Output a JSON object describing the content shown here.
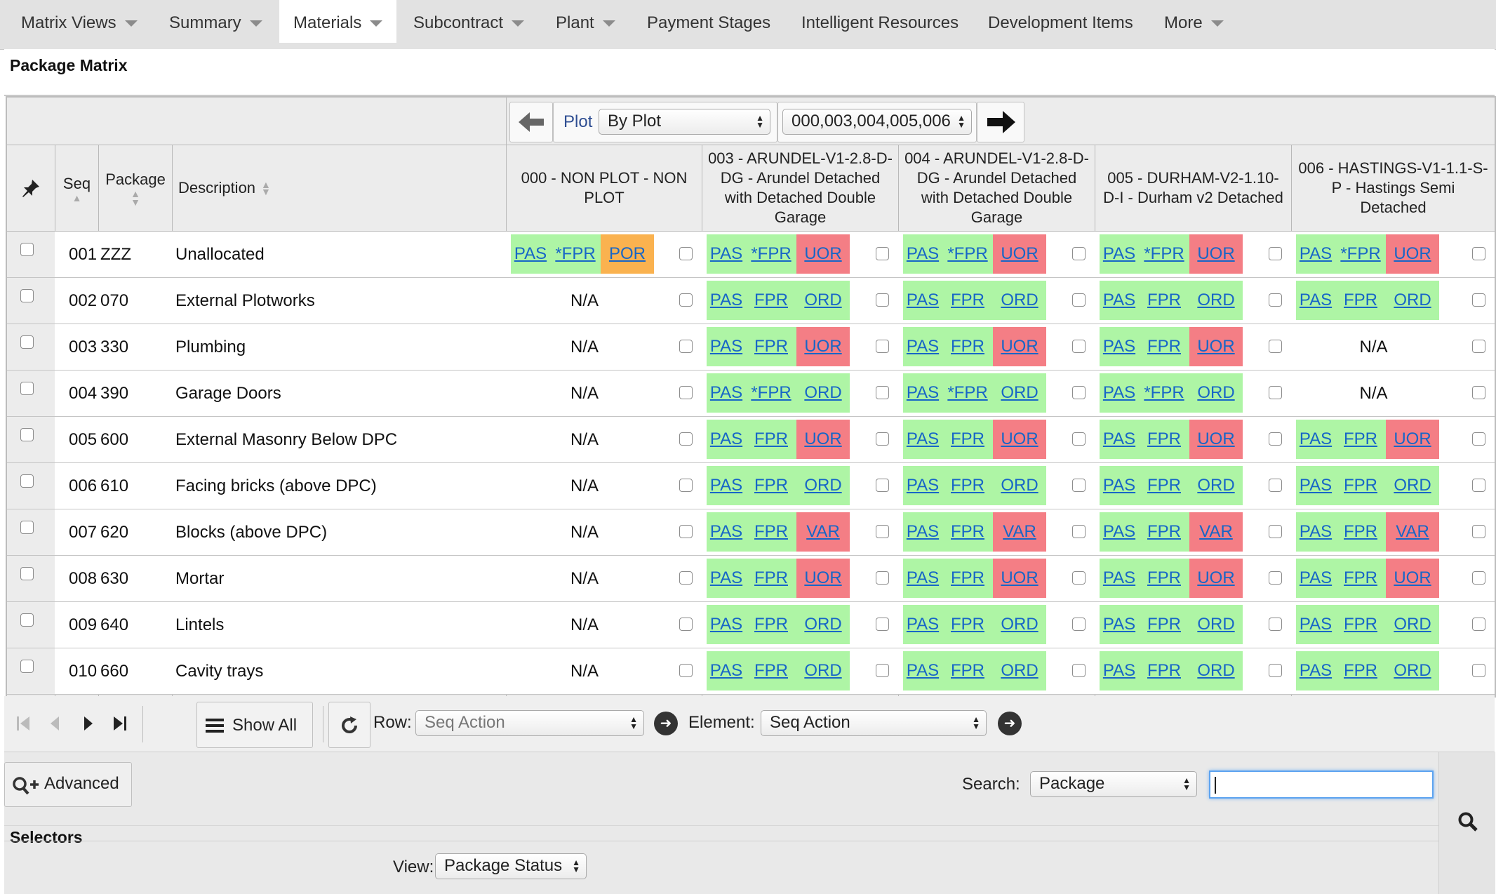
{
  "nav": {
    "tabs": [
      {
        "label": "Matrix Views",
        "has_menu": true
      },
      {
        "label": "Summary",
        "has_menu": true
      },
      {
        "label": "Materials",
        "has_menu": true,
        "active": true
      },
      {
        "label": "Subcontract",
        "has_menu": true
      },
      {
        "label": "Plant",
        "has_menu": true
      },
      {
        "label": "Payment Stages",
        "has_menu": false
      },
      {
        "label": "Intelligent Resources",
        "has_menu": false
      },
      {
        "label": "Development Items",
        "has_menu": false
      },
      {
        "label": "More",
        "has_menu": true
      }
    ]
  },
  "page": {
    "title": "Package Matrix"
  },
  "plot_selector": {
    "label": "Plot",
    "mode": "By Plot",
    "range": "000,003,004,005,006"
  },
  "columns": {
    "seq": "Seq",
    "package": "Package",
    "description": "Description",
    "plots": [
      "000 - NON PLOT - NON PLOT",
      "003 - ARUNDEL-V1-2.8-D-DG - Arundel Detached with Detached Double Garage",
      "004 - ARUNDEL-V1-2.8-D-DG - Arundel Detached with Detached Double Garage",
      "005 - DURHAM-V2-1.10-D-I - Durham v2 Detached",
      "006 - HASTINGS-V1-1.1-S-P - Hastings Semi Detached"
    ]
  },
  "colors": {
    "green": "#aef5a5",
    "red": "#f47e85",
    "orange": "#fab24f",
    "link": "#1766c7"
  },
  "rows": [
    {
      "seq": "001",
      "package": "ZZZ",
      "description": "Unallocated",
      "cells": [
        [
          {
            "t": "PAS",
            "c": "green"
          },
          {
            "t": "*FPR",
            "c": "green"
          },
          {
            "t": "POR",
            "c": "orange"
          }
        ],
        [
          {
            "t": "PAS",
            "c": "green"
          },
          {
            "t": "*FPR",
            "c": "green"
          },
          {
            "t": "UOR",
            "c": "red"
          }
        ],
        [
          {
            "t": "PAS",
            "c": "green"
          },
          {
            "t": "*FPR",
            "c": "green"
          },
          {
            "t": "UOR",
            "c": "red"
          }
        ],
        [
          {
            "t": "PAS",
            "c": "green"
          },
          {
            "t": "*FPR",
            "c": "green"
          },
          {
            "t": "UOR",
            "c": "red"
          }
        ],
        [
          {
            "t": "PAS",
            "c": "green"
          },
          {
            "t": "*FPR",
            "c": "green"
          },
          {
            "t": "UOR",
            "c": "red"
          }
        ]
      ]
    },
    {
      "seq": "002",
      "package": "070",
      "description": "External Plotworks",
      "cells": [
        "N/A",
        [
          {
            "t": "PAS",
            "c": "green"
          },
          {
            "t": "FPR",
            "c": "green"
          },
          {
            "t": "ORD",
            "c": "green"
          }
        ],
        [
          {
            "t": "PAS",
            "c": "green"
          },
          {
            "t": "FPR",
            "c": "green"
          },
          {
            "t": "ORD",
            "c": "green"
          }
        ],
        [
          {
            "t": "PAS",
            "c": "green"
          },
          {
            "t": "FPR",
            "c": "green"
          },
          {
            "t": "ORD",
            "c": "green"
          }
        ],
        [
          {
            "t": "PAS",
            "c": "green"
          },
          {
            "t": "FPR",
            "c": "green"
          },
          {
            "t": "ORD",
            "c": "green"
          }
        ]
      ]
    },
    {
      "seq": "003",
      "package": "330",
      "description": "Plumbing",
      "cells": [
        "N/A",
        [
          {
            "t": "PAS",
            "c": "green"
          },
          {
            "t": "FPR",
            "c": "green"
          },
          {
            "t": "UOR",
            "c": "red"
          }
        ],
        [
          {
            "t": "PAS",
            "c": "green"
          },
          {
            "t": "FPR",
            "c": "green"
          },
          {
            "t": "UOR",
            "c": "red"
          }
        ],
        [
          {
            "t": "PAS",
            "c": "green"
          },
          {
            "t": "FPR",
            "c": "green"
          },
          {
            "t": "UOR",
            "c": "red"
          }
        ],
        "N/A"
      ]
    },
    {
      "seq": "004",
      "package": "390",
      "description": "Garage Doors",
      "cells": [
        "N/A",
        [
          {
            "t": "PAS",
            "c": "green"
          },
          {
            "t": "*FPR",
            "c": "green"
          },
          {
            "t": "ORD",
            "c": "green"
          }
        ],
        [
          {
            "t": "PAS",
            "c": "green"
          },
          {
            "t": "*FPR",
            "c": "green"
          },
          {
            "t": "ORD",
            "c": "green"
          }
        ],
        [
          {
            "t": "PAS",
            "c": "green"
          },
          {
            "t": "*FPR",
            "c": "green"
          },
          {
            "t": "ORD",
            "c": "green"
          }
        ],
        "N/A"
      ]
    },
    {
      "seq": "005",
      "package": "600",
      "description": "External Masonry Below DPC",
      "cells": [
        "N/A",
        [
          {
            "t": "PAS",
            "c": "green"
          },
          {
            "t": "FPR",
            "c": "green"
          },
          {
            "t": "UOR",
            "c": "red"
          }
        ],
        [
          {
            "t": "PAS",
            "c": "green"
          },
          {
            "t": "FPR",
            "c": "green"
          },
          {
            "t": "UOR",
            "c": "red"
          }
        ],
        [
          {
            "t": "PAS",
            "c": "green"
          },
          {
            "t": "FPR",
            "c": "green"
          },
          {
            "t": "UOR",
            "c": "red"
          }
        ],
        [
          {
            "t": "PAS",
            "c": "green"
          },
          {
            "t": "FPR",
            "c": "green"
          },
          {
            "t": "UOR",
            "c": "red"
          }
        ]
      ]
    },
    {
      "seq": "006",
      "package": "610",
      "description": "Facing bricks (above DPC)",
      "cells": [
        "N/A",
        [
          {
            "t": "PAS",
            "c": "green"
          },
          {
            "t": "FPR",
            "c": "green"
          },
          {
            "t": "ORD",
            "c": "green"
          }
        ],
        [
          {
            "t": "PAS",
            "c": "green"
          },
          {
            "t": "FPR",
            "c": "green"
          },
          {
            "t": "ORD",
            "c": "green"
          }
        ],
        [
          {
            "t": "PAS",
            "c": "green"
          },
          {
            "t": "FPR",
            "c": "green"
          },
          {
            "t": "ORD",
            "c": "green"
          }
        ],
        [
          {
            "t": "PAS",
            "c": "green"
          },
          {
            "t": "FPR",
            "c": "green"
          },
          {
            "t": "ORD",
            "c": "green"
          }
        ]
      ]
    },
    {
      "seq": "007",
      "package": "620",
      "description": "Blocks (above DPC)",
      "cells": [
        "N/A",
        [
          {
            "t": "PAS",
            "c": "green"
          },
          {
            "t": "FPR",
            "c": "green"
          },
          {
            "t": "VAR",
            "c": "red"
          }
        ],
        [
          {
            "t": "PAS",
            "c": "green"
          },
          {
            "t": "FPR",
            "c": "green"
          },
          {
            "t": "VAR",
            "c": "red"
          }
        ],
        [
          {
            "t": "PAS",
            "c": "green"
          },
          {
            "t": "FPR",
            "c": "green"
          },
          {
            "t": "VAR",
            "c": "red"
          }
        ],
        [
          {
            "t": "PAS",
            "c": "green"
          },
          {
            "t": "FPR",
            "c": "green"
          },
          {
            "t": "VAR",
            "c": "red"
          }
        ]
      ]
    },
    {
      "seq": "008",
      "package": "630",
      "description": "Mortar",
      "cells": [
        "N/A",
        [
          {
            "t": "PAS",
            "c": "green"
          },
          {
            "t": "FPR",
            "c": "green"
          },
          {
            "t": "UOR",
            "c": "red"
          }
        ],
        [
          {
            "t": "PAS",
            "c": "green"
          },
          {
            "t": "FPR",
            "c": "green"
          },
          {
            "t": "UOR",
            "c": "red"
          }
        ],
        [
          {
            "t": "PAS",
            "c": "green"
          },
          {
            "t": "FPR",
            "c": "green"
          },
          {
            "t": "UOR",
            "c": "red"
          }
        ],
        [
          {
            "t": "PAS",
            "c": "green"
          },
          {
            "t": "FPR",
            "c": "green"
          },
          {
            "t": "UOR",
            "c": "red"
          }
        ]
      ]
    },
    {
      "seq": "009",
      "package": "640",
      "description": "Lintels",
      "cells": [
        "N/A",
        [
          {
            "t": "PAS",
            "c": "green"
          },
          {
            "t": "FPR",
            "c": "green"
          },
          {
            "t": "ORD",
            "c": "green"
          }
        ],
        [
          {
            "t": "PAS",
            "c": "green"
          },
          {
            "t": "FPR",
            "c": "green"
          },
          {
            "t": "ORD",
            "c": "green"
          }
        ],
        [
          {
            "t": "PAS",
            "c": "green"
          },
          {
            "t": "FPR",
            "c": "green"
          },
          {
            "t": "ORD",
            "c": "green"
          }
        ],
        [
          {
            "t": "PAS",
            "c": "green"
          },
          {
            "t": "FPR",
            "c": "green"
          },
          {
            "t": "ORD",
            "c": "green"
          }
        ]
      ]
    },
    {
      "seq": "010",
      "package": "660",
      "description": "Cavity trays",
      "cells": [
        "N/A",
        [
          {
            "t": "PAS",
            "c": "green"
          },
          {
            "t": "FPR",
            "c": "green"
          },
          {
            "t": "ORD",
            "c": "green"
          }
        ],
        [
          {
            "t": "PAS",
            "c": "green"
          },
          {
            "t": "FPR",
            "c": "green"
          },
          {
            "t": "ORD",
            "c": "green"
          }
        ],
        [
          {
            "t": "PAS",
            "c": "green"
          },
          {
            "t": "FPR",
            "c": "green"
          },
          {
            "t": "ORD",
            "c": "green"
          }
        ],
        [
          {
            "t": "PAS",
            "c": "green"
          },
          {
            "t": "FPR",
            "c": "green"
          },
          {
            "t": "ORD",
            "c": "green"
          }
        ]
      ]
    }
  ],
  "pager": {
    "show_all": "Show All",
    "row_label": "Row:",
    "row_action": "Seq Action",
    "element_label": "Element:",
    "element_action": "Seq Action"
  },
  "bottom": {
    "advanced": "Advanced",
    "search_label": "Search:",
    "search_field": "Package",
    "search_value": "",
    "selectors_title": "Selectors",
    "view_label": "View:",
    "view_value": "Package Status"
  },
  "icons": {
    "pin": "pin-icon",
    "prev_plot": "arrow-left-icon",
    "next_plot": "arrow-right-icon",
    "first": "first-page-icon",
    "prev": "prev-page-icon",
    "next": "next-page-icon",
    "last": "last-page-icon",
    "show_all": "list-icon",
    "refresh": "refresh-icon",
    "go": "go-icon",
    "advanced": "zoom-plus-icon",
    "search": "magnifier-icon"
  }
}
